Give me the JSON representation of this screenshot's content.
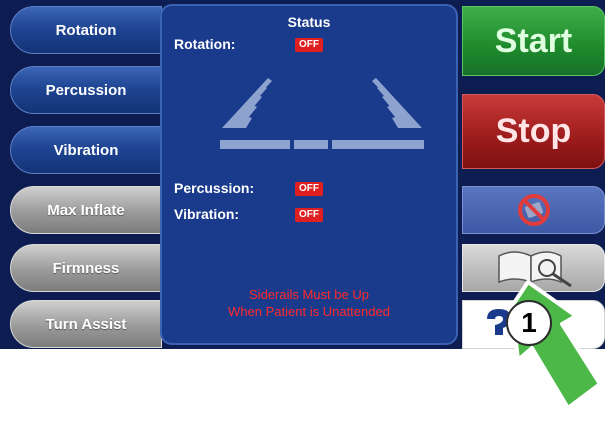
{
  "left_menu": [
    {
      "label": "Rotation",
      "style": "blue"
    },
    {
      "label": "Percussion",
      "style": "blue"
    },
    {
      "label": "Vibration",
      "style": "blue"
    },
    {
      "label": "Max Inflate",
      "style": "gray"
    },
    {
      "label": "Firmness",
      "style": "gray"
    },
    {
      "label": "Turn Assist",
      "style": "gray"
    }
  ],
  "status": {
    "title": "Status",
    "rotation_label": "Rotation:",
    "rotation_value": "OFF",
    "percussion_label": "Percussion:",
    "percussion_value": "OFF",
    "vibration_label": "Vibration:",
    "vibration_value": "OFF",
    "warning_line1": "Siderails Must be Up",
    "warning_line2": "When Patient is Unattended",
    "diagram_icon": "bed-rotation-icon"
  },
  "right_buttons": {
    "start_label": "Start",
    "stop_label": "Stop",
    "silence_icon": "silence-alarm-icon",
    "manual_icon": "manual-book-icon",
    "help_icon": "help-icon"
  },
  "callout": {
    "number": "1",
    "color": "#4cb848"
  },
  "colors": {
    "screen_bg": "#0d1d52",
    "panel_bg": "#1a3b8c",
    "off_badge": "#e02020",
    "warning_text": "#ff2a2a",
    "start_green": "#1e8a2b",
    "stop_red": "#9c1b1b"
  }
}
